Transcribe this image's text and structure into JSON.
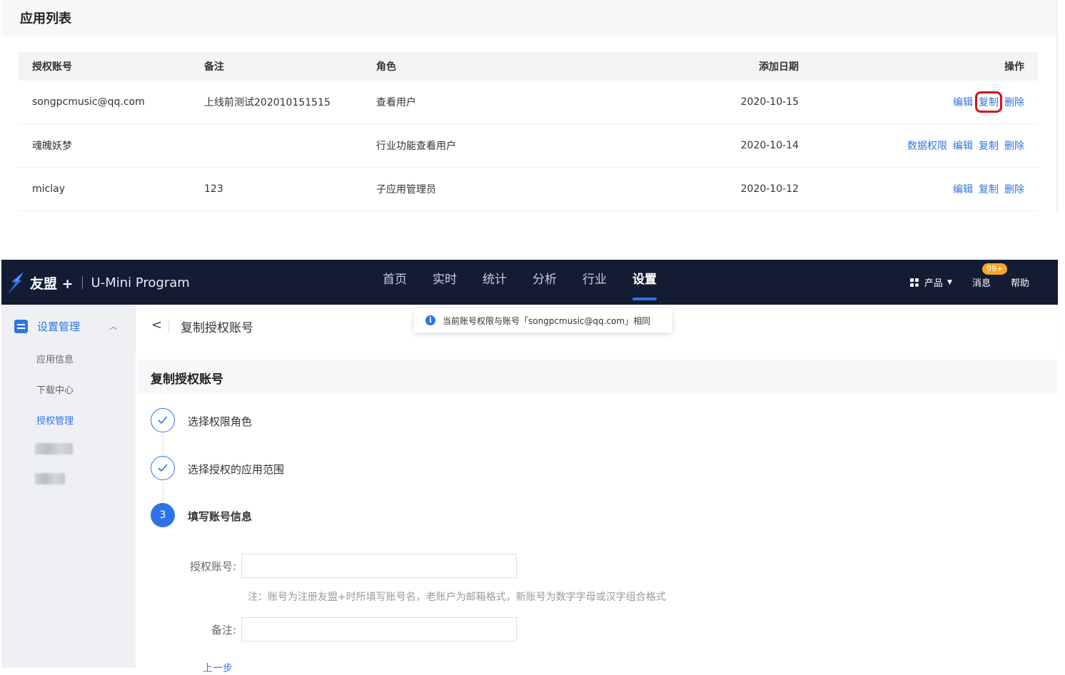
{
  "top_panel": {
    "title": "应用列表",
    "table": {
      "headers": {
        "account": "授权账号",
        "note": "备注",
        "role": "角色",
        "date": "添加日期",
        "ops": "操作"
      },
      "rows": [
        {
          "account": "songpcmusic@qq.com",
          "note": "上线前测试202010151515",
          "role": "查看用户",
          "date": "2020-10-15",
          "ops": [
            "编辑",
            "复制",
            "删除"
          ],
          "highlighted_op": "复制"
        },
        {
          "account": "魂魄妖梦",
          "note": "",
          "role": "行业功能查看用户",
          "date": "2020-10-14",
          "ops": [
            "数据权限",
            "编辑",
            "复制",
            "删除"
          ]
        },
        {
          "account": "miclay",
          "note": "123",
          "role": "子应用管理员",
          "date": "2020-10-12",
          "ops": [
            "编辑",
            "复制",
            "删除"
          ]
        }
      ]
    }
  },
  "navbar": {
    "brand": "友盟 +",
    "product": "U-Mini Program",
    "menu": [
      "首页",
      "实时",
      "统计",
      "分析",
      "行业",
      "设置"
    ],
    "active_menu": "设置",
    "right": {
      "products_label": "产品",
      "messages_label": "消息",
      "messages_badge": "99+",
      "help_label": "帮助"
    }
  },
  "sidebar": {
    "group_label": "设置管理",
    "items": [
      "应用信息",
      "下载中心",
      "授权管理"
    ],
    "active_item": "授权管理"
  },
  "page": {
    "title": "复制授权账号",
    "toast": "当前账号权限与账号「songpcmusic@qq.com」相同",
    "section_title": "复制授权账号",
    "steps": [
      {
        "number": "1",
        "label": "选择权限角色",
        "status": "done"
      },
      {
        "number": "2",
        "label": "选择授权的应用范围",
        "status": "done"
      },
      {
        "number": "3",
        "label": "填写账号信息",
        "status": "current"
      }
    ],
    "form": {
      "account_label": "授权账号:",
      "account_value": "",
      "account_note": "注：账号为注册友盟+时所填写账号名，老账户为邮箱格式，新账号为数字字母或汉字组合格式",
      "remark_label": "备注:",
      "remark_value": "",
      "prev_label": "上一步"
    }
  },
  "colors": {
    "accent": "#2f74e6",
    "navbar_bg": "#141c34",
    "highlight_box": "#d6121b",
    "badge": "#f5a623"
  },
  "icons": {
    "logo": "umeng-logo-icon",
    "back": "chevron-left-icon",
    "info": "info-circle-icon",
    "check": "check-icon",
    "grid": "grid-icon",
    "caret": "caret-down-icon",
    "sidebar_group": "settings-list-icon",
    "collapse": "chevron-up-icon"
  }
}
